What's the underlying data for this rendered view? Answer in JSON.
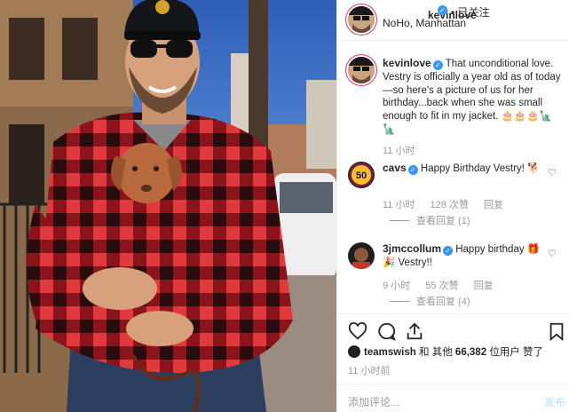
{
  "post": {
    "author": "kevinlove",
    "follow_label": "• 已关注",
    "location": "NoHo, Manhattan"
  },
  "caption": {
    "author": "kevinlove",
    "text": "That unconditional love. Vestry is officially a year old as of today—so here's a picture of us for her birthday...back when she was small enough to fit in my jacket. 🎂🎂🎂🗽🗽",
    "time": "11 小时"
  },
  "comments": [
    {
      "author": "cavs",
      "avatar_text": "50",
      "text": "Happy Birthday Vestry! 🐕",
      "time": "11 小时",
      "likes": "128 次赞",
      "reply_label": "回复",
      "view_replies": "查看回复 (1)"
    },
    {
      "author": "3jmccollum",
      "text": "Happy birthday 🎁🎉 Vestry!!",
      "time": "9 小时",
      "likes": "55 次赞",
      "reply_label": "回复",
      "view_replies": "查看回复 (4)"
    }
  ],
  "likes": {
    "liker": "teamswish",
    "middle": "和 其他",
    "count": "66,382",
    "suffix": "位用户 赞了"
  },
  "posted_ago": "11 小时前",
  "add_comment": {
    "placeholder": "添加评论...",
    "post_label": "发布"
  },
  "icons": {
    "like": "heart-icon",
    "comment": "comment-bubble-icon",
    "share": "share-icon",
    "save": "bookmark-icon",
    "verified": "verified-badge-icon"
  },
  "colors": {
    "verified": "#3897f0",
    "text": "#262626",
    "muted": "#999999",
    "post_disabled": "#b2dffc",
    "flannel_red": "#c8202a"
  }
}
